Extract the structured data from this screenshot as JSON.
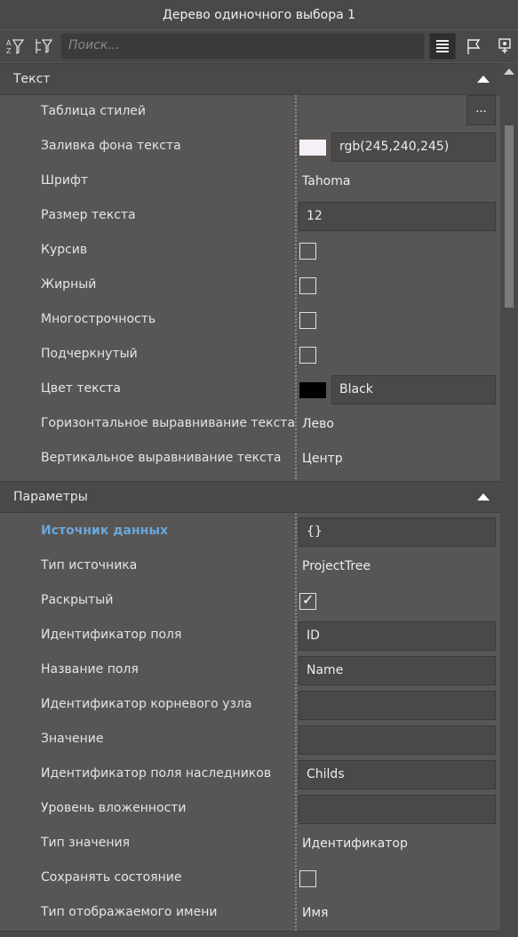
{
  "window": {
    "title": "Дерево одиночного выбора 1"
  },
  "toolbar": {
    "search_placeholder": "Поиск...",
    "buttons": [
      "sort-filter-icon",
      "tree-filter-icon",
      "list-view-icon",
      "flag-icon",
      "event-icon"
    ]
  },
  "sections": {
    "text": {
      "title": "Текст",
      "rows": {
        "stylesheet": {
          "label": "Таблица стилей",
          "button": "..."
        },
        "background": {
          "label": "Заливка фона текста",
          "value": "rgb(245,240,245)",
          "swatch": "#f5f0f5"
        },
        "font": {
          "label": "Шрифт",
          "value": "Tahoma"
        },
        "size": {
          "label": "Размер текста",
          "value": "12"
        },
        "italic": {
          "label": "Курсив",
          "checked": false
        },
        "bold": {
          "label": "Жирный",
          "checked": false
        },
        "multiline": {
          "label": "Многострочность",
          "checked": false
        },
        "underline": {
          "label": "Подчеркнутый",
          "checked": false
        },
        "color": {
          "label": "Цвет текста",
          "value": "Black",
          "swatch": "#000000"
        },
        "halign": {
          "label": "Горизонтальное выравнивание текста",
          "value": "Лево"
        },
        "valign": {
          "label": "Вертикальное выравнивание текста",
          "value": "Центр"
        }
      }
    },
    "params": {
      "title": "Параметры",
      "rows": {
        "datasource": {
          "label": "Источник данных",
          "value": "{}"
        },
        "sourcetype": {
          "label": "Тип источника",
          "value": "ProjectTree"
        },
        "expanded": {
          "label": "Раскрытый",
          "checked": true,
          "mark": "✓"
        },
        "fieldid": {
          "label": "Идентификатор поля",
          "value": "ID"
        },
        "fieldname": {
          "label": "Название поля",
          "value": "Name"
        },
        "rootid": {
          "label": "Идентификатор корневого узла",
          "value": ""
        },
        "value": {
          "label": "Значение",
          "value": ""
        },
        "childfield": {
          "label": "Идентификатор поля наследников",
          "value": "Childs"
        },
        "depth": {
          "label": "Уровень вложенности",
          "value": ""
        },
        "valuetype": {
          "label": "Тип значения",
          "value": "Идентификатор"
        },
        "savestate": {
          "label": "Сохранять состояние",
          "checked": false
        },
        "displayname": {
          "label": "Тип отображаемого имени",
          "value": "Имя"
        }
      }
    }
  },
  "colors": {
    "accent_label": "#6aa6da",
    "background": "#575654",
    "header": "#4a4948"
  }
}
